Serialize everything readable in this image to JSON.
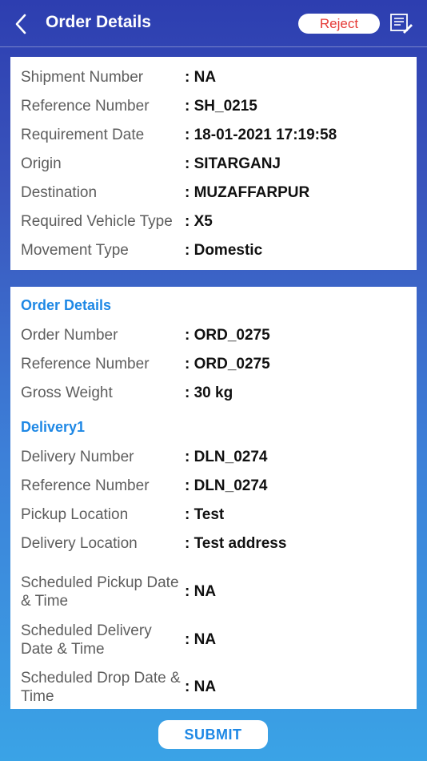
{
  "header": {
    "title": "Order Details",
    "reject_label": "Reject",
    "back_icon": "chevron-left-icon",
    "notes_icon": "notes-edit-icon"
  },
  "shipment": [
    {
      "label": "Shipment Number",
      "value": ": NA"
    },
    {
      "label": "Reference Number",
      "value": ": SH_0215"
    },
    {
      "label": "Requirement Date",
      "value": ": 18-01-2021 17:19:58"
    },
    {
      "label": "Origin",
      "value": ": SITARGANJ"
    },
    {
      "label": "Destination",
      "value": ": MUZAFFARPUR"
    },
    {
      "label": "Required Vehicle Type",
      "value": ": X5"
    },
    {
      "label": "Movement Type",
      "value": ": Domestic"
    }
  ],
  "order": {
    "heading": "Order Details",
    "rows": [
      {
        "label": "Order Number",
        "value": ": ORD_0275"
      },
      {
        "label": "Reference Number",
        "value": ": ORD_0275"
      },
      {
        "label": "Gross Weight",
        "value": ": 30 kg"
      }
    ]
  },
  "delivery": {
    "heading": "Delivery1",
    "rows": [
      {
        "label": "Delivery Number",
        "value": ": DLN_0274"
      },
      {
        "label": "Reference Number",
        "value": ": DLN_0274"
      },
      {
        "label": "Pickup Location",
        "value": ": Test"
      },
      {
        "label": "Delivery Location",
        "value": ": Test address"
      },
      {
        "label": "Scheduled Pickup Date & Time",
        "value": ": NA"
      },
      {
        "label": "Scheduled Delivery Date & Time",
        "value": ": NA"
      },
      {
        "label": "Scheduled Drop Date & Time",
        "value": ": NA"
      }
    ]
  },
  "footer": {
    "submit_label": "SUBMIT"
  },
  "colors": {
    "accent": "#1e88e5",
    "reject": "#e53935",
    "header_bg": "#2d3eb0"
  }
}
